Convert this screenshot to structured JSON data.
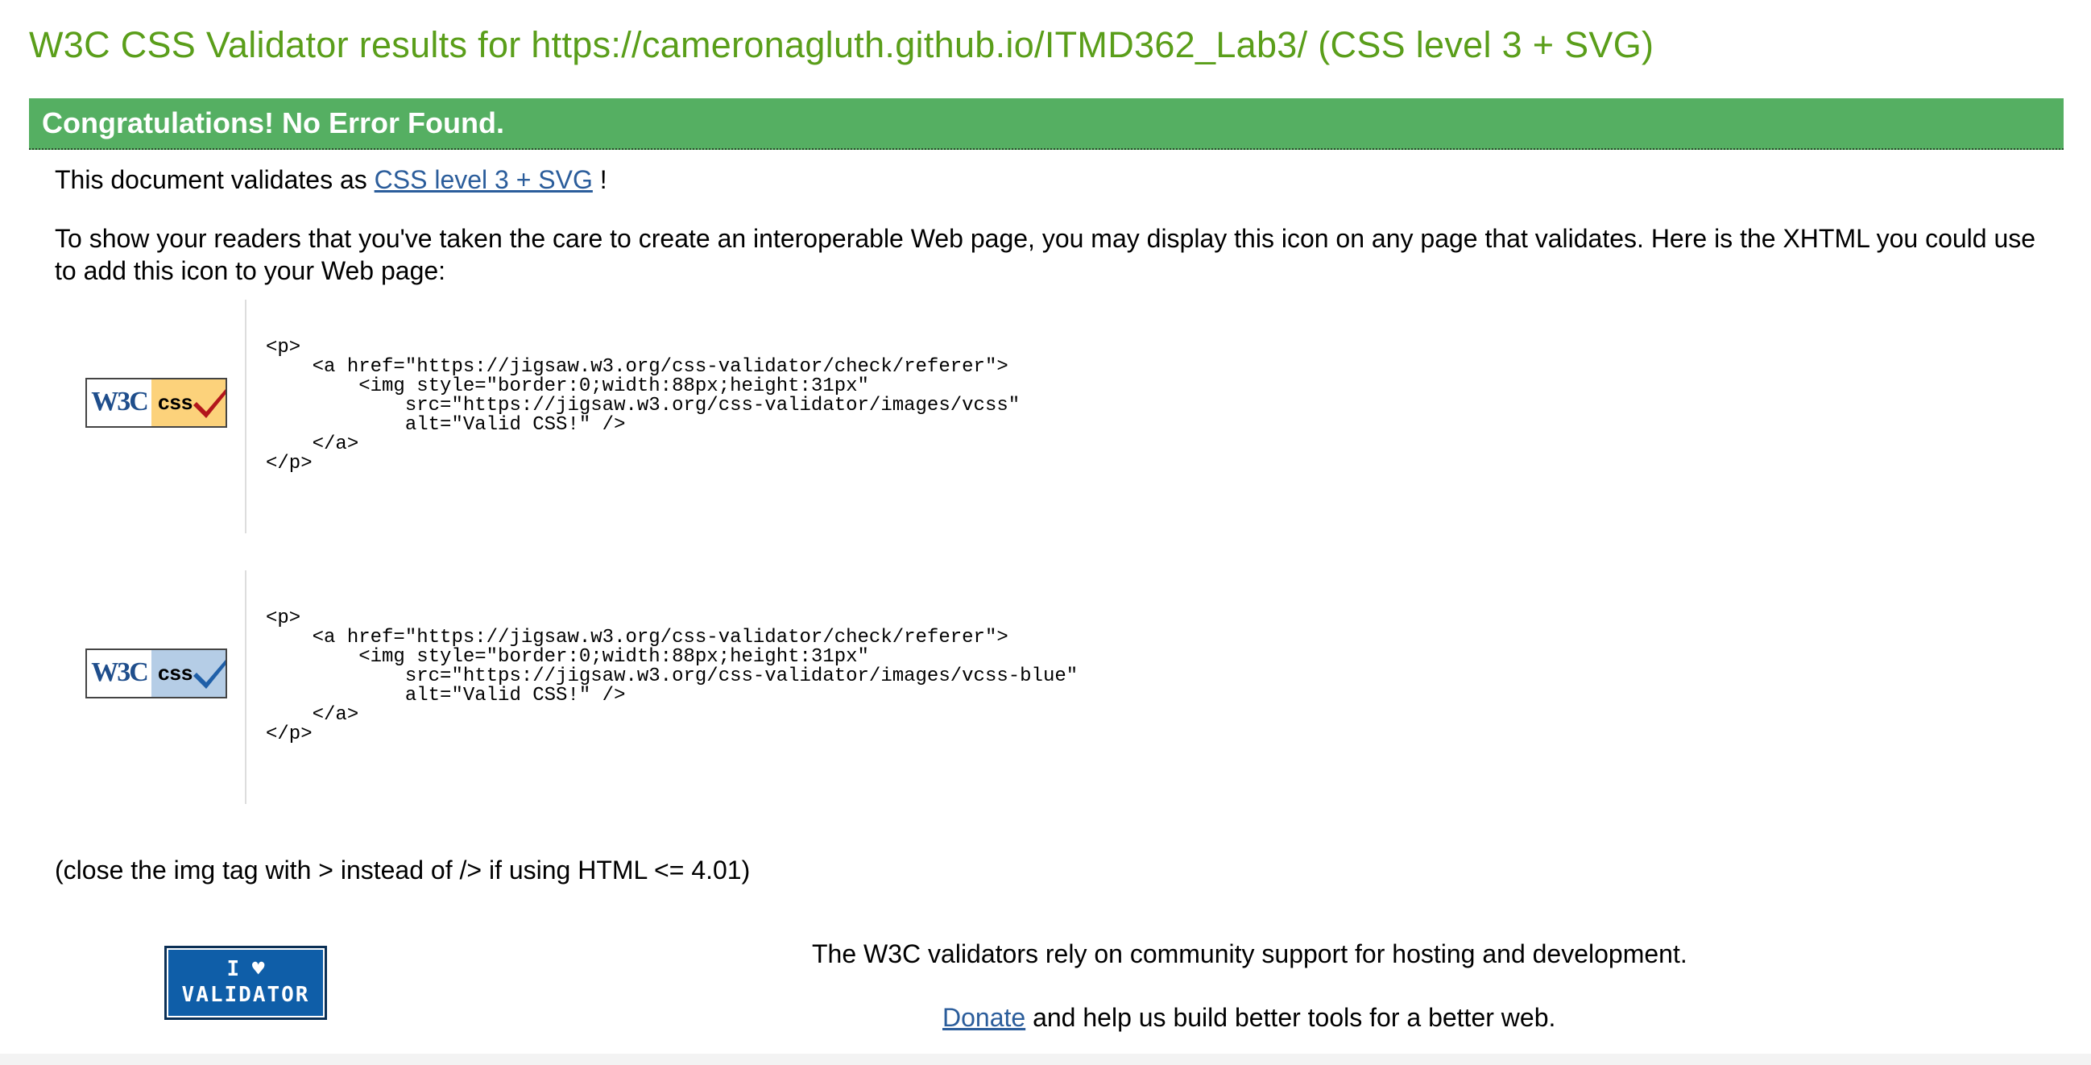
{
  "header": {
    "title": "W3C CSS Validator results for https://cameronagluth.github.io/ITMD362_Lab3/ (CSS level 3 + SVG)"
  },
  "congrats": {
    "text": "Congratulations! No Error Found."
  },
  "validates": {
    "prefix": "This document validates as ",
    "link": "CSS level 3 + SVG",
    "suffix": " !"
  },
  "readers_text": "To show your readers that you've taken the care to create an interoperable Web page, you may display this icon on any page that validates. Here is the XHTML you could use to add this icon to your Web page:",
  "badges": [
    {
      "icon": "w3c-css-gold-badge",
      "w3c_text": "W3C",
      "css_text": "css",
      "check_color": "#b3151b",
      "code": "<p>\n    <a href=\"https://jigsaw.w3.org/css-validator/check/referer\">\n        <img style=\"border:0;width:88px;height:31px\"\n            src=\"https://jigsaw.w3.org/css-validator/images/vcss\"\n            alt=\"Valid CSS!\" />\n    </a>\n</p>"
    },
    {
      "icon": "w3c-css-blue-badge",
      "w3c_text": "W3C",
      "css_text": "css",
      "check_color": "#1f5fa8",
      "code": "<p>\n    <a href=\"https://jigsaw.w3.org/css-validator/check/referer\">\n        <img style=\"border:0;width:88px;height:31px\"\n            src=\"https://jigsaw.w3.org/css-validator/images/vcss-blue\"\n            alt=\"Valid CSS!\" />\n    </a>\n</p>"
    }
  ],
  "close_note": "(close the img tag with > instead of /> if using HTML <= 4.01)",
  "ilove_badge": {
    "line1": "I ♥",
    "line2": "VALIDATOR"
  },
  "support_text": "The W3C validators rely on community support for hosting and development.",
  "donate": {
    "link": "Donate",
    "suffix": " and help us build better tools for a better web."
  },
  "colors": {
    "title_green": "#5a9e1a",
    "congrats_bg": "#55af62",
    "link_blue": "#2b5d9b"
  }
}
